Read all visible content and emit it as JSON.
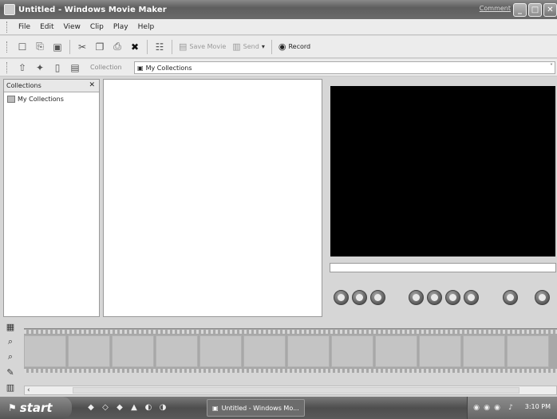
{
  "window": {
    "title": "Untitled - Windows Movie Maker",
    "comment_link": "Comment",
    "min_glyph": "_",
    "max_glyph": "□",
    "close_glyph": "✕"
  },
  "menu": [
    "File",
    "Edit",
    "View",
    "Clip",
    "Play",
    "Help"
  ],
  "toolbar": {
    "save_movie_label": "Save Movie",
    "send_label": "Send",
    "record_label": "Record"
  },
  "collection_bar": {
    "label": "Collection",
    "selected": "My Collections",
    "chevron": "˅"
  },
  "collections_pane": {
    "header": "Collections",
    "close_glyph": "✕",
    "items": [
      "My Collections"
    ]
  },
  "player": {
    "buttons": [
      "play",
      "pause",
      "stop",
      "back",
      "previous-frame",
      "next-frame",
      "forward",
      "split-clip",
      "take-picture"
    ]
  },
  "taskbar": {
    "start_label": "start",
    "task_item": "Untitled - Windows Mo...",
    "clock": "3:10 PM"
  },
  "icons": {
    "new": "☐",
    "open": "⎘",
    "save": "▣",
    "cut": "✂",
    "copy": "❐",
    "paste": "⎙",
    "delete": "✖",
    "properties": "☷",
    "save_movie": "▤",
    "send": "▥",
    "record": "◉"
  }
}
